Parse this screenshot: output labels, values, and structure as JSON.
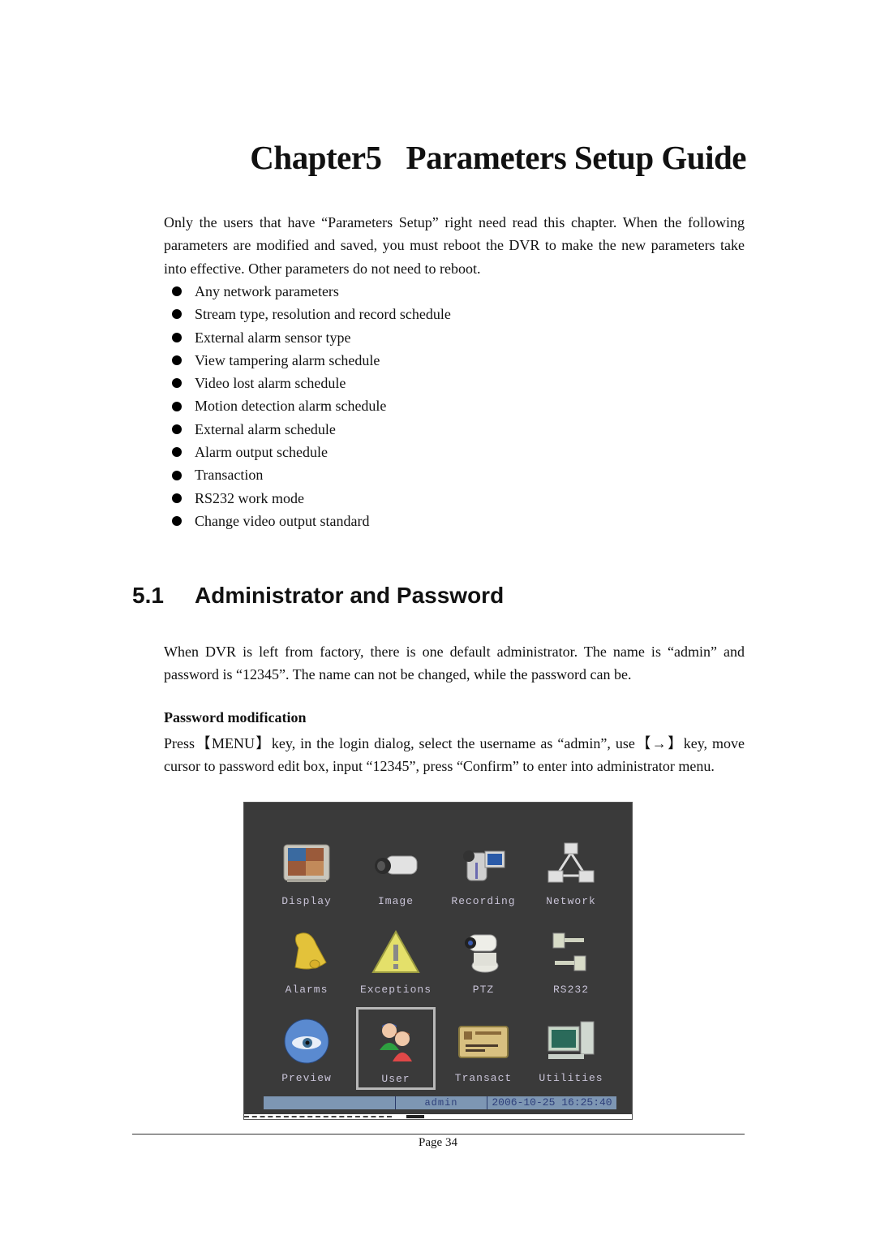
{
  "chapter": {
    "number": "Chapter5",
    "title": "Parameters Setup Guide"
  },
  "intro": {
    "paragraph": "Only the users that have “Parameters Setup” right need read this chapter. When the following parameters are modified and saved, you must reboot the DVR to make the new parameters take into effective. Other parameters do not need to reboot.",
    "bullets": [
      "Any network parameters",
      "Stream type, resolution and record schedule",
      "External alarm sensor type",
      "View tampering alarm schedule",
      "Video lost alarm schedule",
      "Motion detection alarm schedule",
      "External alarm schedule",
      "Alarm output schedule",
      "Transaction",
      "RS232 work mode",
      "Change video output standard"
    ]
  },
  "section": {
    "number": "5.1",
    "title": "Administrator and Password",
    "paragraph": "When DVR is left from factory, there is one default administrator. The name is “admin” and password is “12345”. The name can not be changed, while the password can be.",
    "subheading": "Password modification",
    "instructions": "Press【MENU】key, in the login dialog, select the username as “admin”, use【→】key, move cursor to password edit box, input “12345”, press “Confirm” to enter into administrator menu."
  },
  "dvr_menu": {
    "items": [
      {
        "label": "Display",
        "icon": "monitor-icon"
      },
      {
        "label": "Image",
        "icon": "camera-icon"
      },
      {
        "label": "Recording",
        "icon": "camcorder-icon"
      },
      {
        "label": "Network",
        "icon": "network-icon"
      },
      {
        "label": "Alarms",
        "icon": "bell-icon"
      },
      {
        "label": "Exceptions",
        "icon": "warning-icon"
      },
      {
        "label": "PTZ",
        "icon": "ptz-camera-icon"
      },
      {
        "label": "RS232",
        "icon": "serial-cable-icon"
      },
      {
        "label": "Preview",
        "icon": "eye-icon"
      },
      {
        "label": "User",
        "icon": "users-icon"
      },
      {
        "label": "Transact",
        "icon": "card-icon"
      },
      {
        "label": "Utilities",
        "icon": "computer-icon"
      }
    ],
    "selected": "User",
    "status": {
      "user": "admin",
      "datetime": "2006-10-25 16:25:40"
    }
  },
  "footer": {
    "page": "Page 34"
  }
}
